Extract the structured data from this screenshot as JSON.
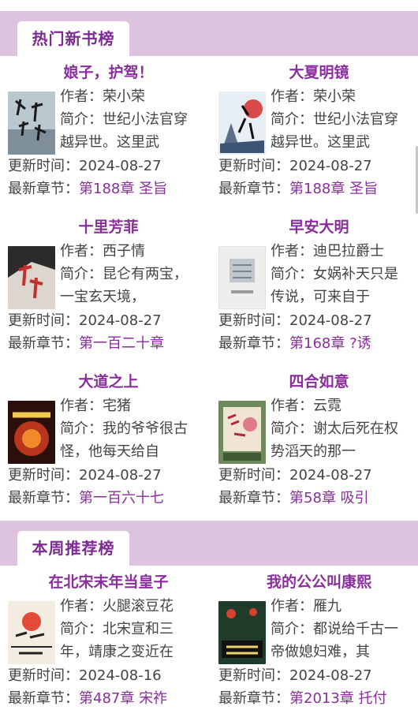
{
  "sections": [
    {
      "title": "热门新书榜",
      "books": [
        {
          "title": "娘子，护驾！",
          "author_label": "作者：",
          "author": "荣小荣",
          "intro_label": "简介：",
          "intro": "世纪小法官穿越异世。这里武",
          "update_label": "更新时间：",
          "update": "2024-08-27",
          "chapter_label": "最新章节：",
          "chapter": "第188章 圣旨",
          "cover_text": "娘子护驾"
        },
        {
          "title": "大夏明镜",
          "author_label": "作者：",
          "author": "荣小荣",
          "intro_label": "简介：",
          "intro": "世纪小法官穿越异世。这里武",
          "update_label": "更新时间：",
          "update": "2024-08-27",
          "chapter_label": "最新章节：",
          "chapter": "第188章 圣旨",
          "cover_text": "大夏明镜"
        },
        {
          "title": "十里芳菲",
          "author_label": "作者：",
          "author": "西子情",
          "intro_label": "简介：",
          "intro": "昆仑有两宝，一宝玄天境，",
          "update_label": "更新时间：",
          "update": "2024-08-27",
          "chapter_label": "最新章节：",
          "chapter": "第一百二十章",
          "cover_text": "十里芳菲"
        },
        {
          "title": "早安大明",
          "author_label": "作者：",
          "author": "迪巴拉爵士",
          "intro_label": "简介：",
          "intro": "女娲补天只是传说，可来自于",
          "update_label": "更新时间：",
          "update": "2024-08-27",
          "chapter_label": "最新章节：",
          "chapter": "第168章 ?诱",
          "cover_text": "早安大明"
        },
        {
          "title": "大道之上",
          "author_label": "作者：",
          "author": "宅猪",
          "intro_label": "简介：",
          "intro": "我的爷爷很古怪，他每天给自",
          "update_label": "更新时间：",
          "update": "2024-08-27",
          "chapter_label": "最新章节：",
          "chapter": "第一百六十七",
          "cover_text": "大道之上"
        },
        {
          "title": "四合如意",
          "author_label": "作者：",
          "author": "云霓",
          "intro_label": "简介：",
          "intro": "谢太后死在权势滔天的那一",
          "update_label": "更新时间：",
          "update": "2024-08-27",
          "chapter_label": "最新章节：",
          "chapter": "第58章 吸引",
          "cover_text": "四合如意"
        }
      ]
    },
    {
      "title": "本周推荐榜",
      "books": [
        {
          "title": "在北宋末年当皇子",
          "author_label": "作者：",
          "author": "火腿滚豆花",
          "intro_label": "简介：",
          "intro": "北宋宣和三年，靖康之变近在",
          "update_label": "更新时间：",
          "update": "2024-08-16",
          "chapter_label": "最新章节：",
          "chapter": "第487章 宋祚",
          "cover_text": "北宋末年当皇子"
        },
        {
          "title": "我的公公叫康熙",
          "author_label": "作者：",
          "author": "雁九",
          "intro_label": "简介：",
          "intro": "都说给千古一帝做媳妇难，其",
          "update_label": "更新时间：",
          "update": "2024-08-27",
          "chapter_label": "最新章节：",
          "chapter": "第2013章 托付",
          "cover_text": "我的公公叫康熙"
        }
      ]
    }
  ],
  "colors": {
    "accent": "#8a2e9c",
    "header_band": "#dec3e0",
    "text": "#444444"
  }
}
